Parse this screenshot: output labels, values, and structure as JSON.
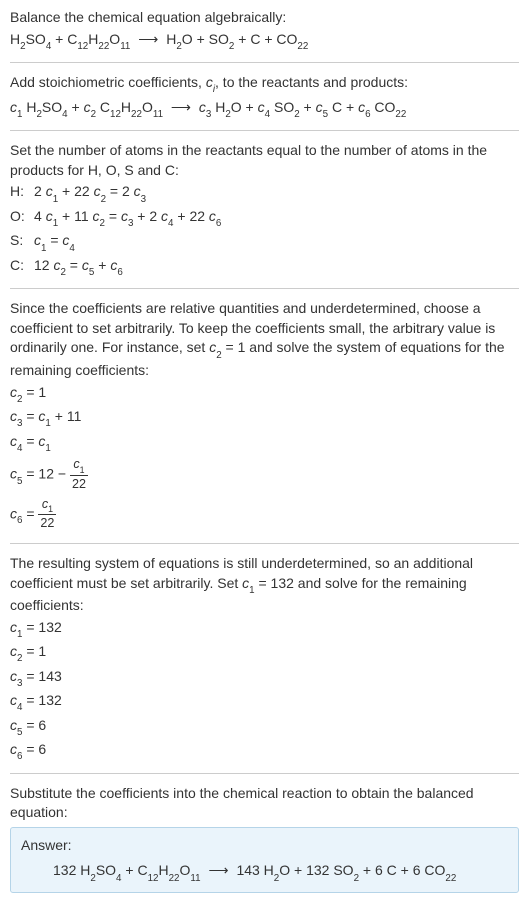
{
  "intro": {
    "line1": "Balance the chemical equation algebraically:",
    "reactant1": "H",
    "r1_sub1": "2",
    "reactant1b": "SO",
    "r1_sub2": "4",
    "plus1": " + ",
    "reactant2": "C",
    "r2_sub1": "12",
    "reactant2b": "H",
    "r2_sub2": "22",
    "reactant2c": "O",
    "r2_sub3": "11",
    "arrow": "⟶",
    "product1": "H",
    "p1_sub1": "2",
    "product1b": "O",
    "plus2": " + ",
    "product2": "SO",
    "p2_sub1": "2",
    "plus3": " + ",
    "product3": "C",
    "plus4": " + ",
    "product4": "CO",
    "p4_sub1": "22"
  },
  "step2": {
    "line1a": "Add stoichiometric coefficients, ",
    "ci": "c",
    "ci_sub": "i",
    "line1b": ", to the reactants and products:",
    "c1": "c",
    "c1s": "1",
    "sp1": " H",
    "h2": "2",
    "so": "SO",
    "so4": "4",
    "pl1": " + ",
    "c2": "c",
    "c2s": "2",
    "sp2": " C",
    "c12": "12",
    "h": "H",
    "h22": "22",
    "o": "O",
    "o11": "11",
    "arr": "⟶",
    "c3": "c",
    "c3s": "3",
    "sp3": " H",
    "h2b": "2",
    "ob": "O",
    "pl2": " + ",
    "c4": "c",
    "c4s": "4",
    "sp4": " SO",
    "so2": "2",
    "pl3": " + ",
    "c5": "c",
    "c5s": "5",
    "sp5": " C",
    "pl4": " + ",
    "c6": "c",
    "c6s": "6",
    "sp6": " CO",
    "co22": "22"
  },
  "step3": {
    "text": "Set the number of atoms in the reactants equal to the number of atoms in the products for H, O, S and C:",
    "rows": [
      {
        "label": "H:",
        "eq_a": "2 ",
        "c1": "c",
        "s1": "1",
        "mid1": " + 22 ",
        "c2": "c",
        "s2": "2",
        "mid2": " = 2 ",
        "c3": "c",
        "s3": "3"
      },
      {
        "label": "O:",
        "eq_a": "4 ",
        "c1": "c",
        "s1": "1",
        "mid1": " + 11 ",
        "c2": "c",
        "s2": "2",
        "mid2": " = ",
        "c3": "c",
        "s3": "3",
        "mid3": " + 2 ",
        "c4": "c",
        "s4": "4",
        "mid4": " + 22 ",
        "c5": "c",
        "s5": "6"
      },
      {
        "label": "S:",
        "c1": "c",
        "s1": "1",
        "mid1": " = ",
        "c2": "c",
        "s2": "4"
      },
      {
        "label": "C:",
        "eq_a": "12 ",
        "c1": "c",
        "s1": "2",
        "mid1": " = ",
        "c2": "c",
        "s2": "5",
        "mid2": " + ",
        "c3": "c",
        "s3": "6"
      }
    ]
  },
  "step4": {
    "text1": "Since the coefficients are relative quantities and underdetermined, choose a coefficient to set arbitrarily. To keep the coefficients small, the arbitrary value is ordinarily one. For instance, set ",
    "c2": "c",
    "c2s": "2",
    "text2": " = 1 and solve the system of equations for the remaining coefficients:",
    "eqs": {
      "e1": {
        "c": "c",
        "s": "2",
        "rhs": " = 1"
      },
      "e2": {
        "c": "c",
        "s": "3",
        "mid": " = ",
        "ca": "c",
        "sa": "1",
        "tail": " + 11"
      },
      "e3": {
        "c": "c",
        "s": "4",
        "mid": " = ",
        "ca": "c",
        "sa": "1"
      },
      "e4": {
        "c": "c",
        "s": "5",
        "mid": " = 12 − ",
        "num_c": "c",
        "num_s": "1",
        "den": "22"
      },
      "e5": {
        "c": "c",
        "s": "6",
        "mid": " = ",
        "num_c": "c",
        "num_s": "1",
        "den": "22"
      }
    }
  },
  "step5": {
    "text1": "The resulting system of equations is still underdetermined, so an additional coefficient must be set arbitrarily. Set ",
    "c1": "c",
    "c1s": "1",
    "text2": " = 132 and solve for the remaining coefficients:",
    "eqs": [
      {
        "c": "c",
        "s": "1",
        "v": " = 132"
      },
      {
        "c": "c",
        "s": "2",
        "v": " = 1"
      },
      {
        "c": "c",
        "s": "3",
        "v": " = 143"
      },
      {
        "c": "c",
        "s": "4",
        "v": " = 132"
      },
      {
        "c": "c",
        "s": "5",
        "v": " = 6"
      },
      {
        "c": "c",
        "s": "6",
        "v": " = 6"
      }
    ]
  },
  "step6": {
    "text": "Substitute the coefficients into the chemical reaction to obtain the balanced equation:"
  },
  "answer": {
    "label": "Answer:",
    "n1": "132 H",
    "s1": "2",
    "t1": "SO",
    "s2": "4",
    "pl1": " + C",
    "s3": "12",
    "t2": "H",
    "s4": "22",
    "t3": "O",
    "s5": "11",
    "arr": "⟶",
    "n2": "143 H",
    "s6": "2",
    "t4": "O + 132 SO",
    "s7": "2",
    "t5": " + 6 C + 6 CO",
    "s8": "22"
  }
}
